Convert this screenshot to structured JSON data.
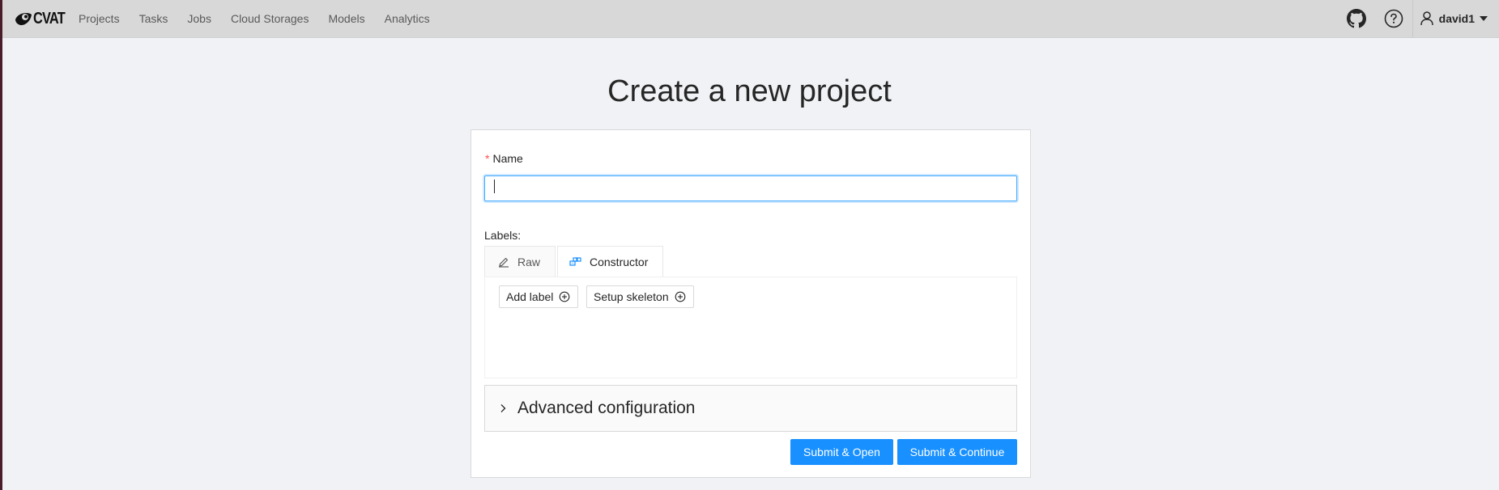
{
  "app": {
    "logo_text": "CVAT"
  },
  "nav": {
    "items": [
      {
        "label": "Projects"
      },
      {
        "label": "Tasks"
      },
      {
        "label": "Jobs"
      },
      {
        "label": "Cloud Storages"
      },
      {
        "label": "Models"
      },
      {
        "label": "Analytics"
      }
    ]
  },
  "header": {
    "icons": [
      "github-icon",
      "help-icon",
      "user-icon",
      "caret-down-icon"
    ],
    "user_name": "david1"
  },
  "page": {
    "title": "Create a new project"
  },
  "form": {
    "name_required_mark": "*",
    "name_label": "Name",
    "name_value": "",
    "labels_caption": "Labels:",
    "tabs": [
      {
        "label": "Raw",
        "icon": "edit-icon",
        "active": false
      },
      {
        "label": "Constructor",
        "icon": "build-icon",
        "active": true
      }
    ],
    "add_label_button": "Add label",
    "setup_skeleton_button": "Setup skeleton",
    "advanced_title": "Advanced configuration",
    "submit_open_button": "Submit & Open",
    "submit_continue_button": "Submit & Continue"
  },
  "colors": {
    "primary": "#1890ff",
    "required": "#ff4d4f",
    "header_bg": "#d8d8d8",
    "page_bg": "#f1f2f5"
  }
}
